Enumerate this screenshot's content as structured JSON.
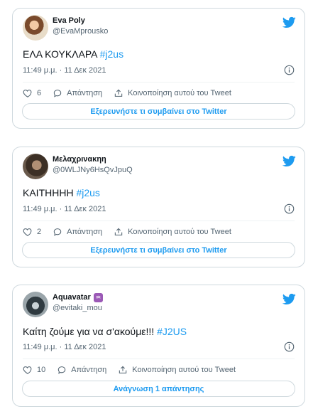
{
  "colors": {
    "accent": "#1d9bf0",
    "text": "#0f1419",
    "muted": "#536471",
    "border": "#cfd9de"
  },
  "tweets": [
    {
      "display_name": "Eva Poly",
      "handle": "@EvaMprousko",
      "text": "ΕΛΑ ΚΟΥΚΛΑΡΑ ",
      "hashtag": "#j2us",
      "timestamp": "11:49 μ.μ. · 11 Δεκ 2021",
      "likes": "6",
      "reply_label": "Απάντηση",
      "share_label": "Κοινοποίηση αυτού του Tweet",
      "cta_label": "Εξερευνήστε τι συμβαίνει στο Twitter"
    },
    {
      "display_name": "Μελαχρινακηη",
      "handle": "@0WLJNy6HsQvJpuQ",
      "text": "ΚΑΙΤΗΗΗΗ ",
      "hashtag": "#j2us",
      "timestamp": "11:49 μ.μ. · 11 Δεκ 2021",
      "likes": "2",
      "reply_label": "Απάντηση",
      "share_label": "Κοινοποίηση αυτού του Tweet",
      "cta_label": "Εξερευνήστε τι συμβαίνει στο Twitter"
    },
    {
      "display_name": "Aquavatar",
      "name_emoji": "♒",
      "handle": "@evitaki_mou",
      "text": "Καίτη ζούμε για να σ'ακούμε!!!  ",
      "hashtag": "#J2US",
      "timestamp": "11:49 μ.μ. · 11 Δεκ 2021",
      "likes": "10",
      "reply_label": "Απάντηση",
      "share_label": "Κοινοποίηση αυτού του Tweet",
      "cta_label": "Ανάγνωση 1 απάντησης"
    }
  ]
}
